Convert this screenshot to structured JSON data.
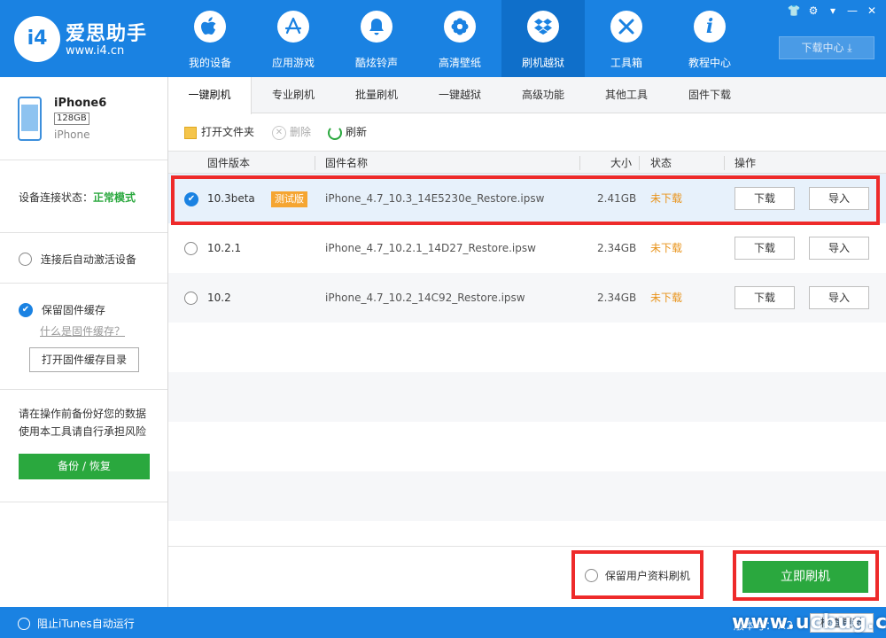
{
  "app": {
    "logo_mark": "i4",
    "title": "爱思助手",
    "url": "www.i4.cn"
  },
  "nav": [
    {
      "label": "我的设备",
      "icon": "apple-icon",
      "glyph": ""
    },
    {
      "label": "应用游戏",
      "icon": "app-store-icon",
      "glyph": "A"
    },
    {
      "label": "酷炫铃声",
      "icon": "bell-icon",
      "glyph": "🔔"
    },
    {
      "label": "高清壁纸",
      "icon": "flower-icon",
      "glyph": "✿"
    },
    {
      "label": "刷机越狱",
      "icon": "dropbox-icon",
      "glyph": "◈"
    },
    {
      "label": "工具箱",
      "icon": "tools-icon",
      "glyph": "✂"
    },
    {
      "label": "教程中心",
      "icon": "info-icon",
      "glyph": "i"
    }
  ],
  "window": {
    "download_center": "下载中心 ⤓"
  },
  "device": {
    "name": "iPhone6",
    "capacity": "128GB",
    "type": "iPhone"
  },
  "connection": {
    "label": "设备连接状态：",
    "mode": "正常模式"
  },
  "options": {
    "auto_activate": "连接后自动激活设备",
    "keep_cache": "保留固件缓存",
    "what_is_cache": "什么是固件缓存？",
    "open_cache_dir": "打开固件缓存目录"
  },
  "risk": {
    "line1": "请在操作前备份好您的数据",
    "line2": "使用本工具请自行承担风险",
    "backup_button": "备份 / 恢复"
  },
  "tabs": [
    "一键刷机",
    "专业刷机",
    "批量刷机",
    "一键越狱",
    "高级功能",
    "其他工具",
    "固件下载"
  ],
  "toolbar": {
    "open_folder": "打开文件夹",
    "delete": "删除",
    "refresh": "刷新"
  },
  "table": {
    "headers": {
      "version": "固件版本",
      "name": "固件名称",
      "size": "大小",
      "status": "状态",
      "action": "操作"
    },
    "rows": [
      {
        "version": "10.3beta",
        "tag": "测试版",
        "name": "iPhone_4.7_10.3_14E5230e_Restore.ipsw",
        "size": "2.41GB",
        "status": "未下载",
        "download": "下载",
        "import": "导入"
      },
      {
        "version": "10.2.1",
        "tag": "",
        "name": "iPhone_4.7_10.2.1_14D27_Restore.ipsw",
        "size": "2.34GB",
        "status": "未下载",
        "download": "下载",
        "import": "导入"
      },
      {
        "version": "10.2",
        "tag": "",
        "name": "iPhone_4.7_10.2_14C92_Restore.ipsw",
        "size": "2.34GB",
        "status": "未下载",
        "download": "下载",
        "import": "导入"
      }
    ]
  },
  "bottom": {
    "keep_user_data": "保留用户资料刷机",
    "flash_now": "立即刷机"
  },
  "footer": {
    "block_itunes": "阻止iTunes自动运行",
    "version": "版本号：7.2",
    "check_update": "检查更新",
    "watermark": "www.ucbug.cc"
  },
  "colors": {
    "brand_blue": "#1a82e2",
    "green": "#2aa83e",
    "orange": "#e8931a",
    "highlight_red": "#ee2a2a"
  }
}
